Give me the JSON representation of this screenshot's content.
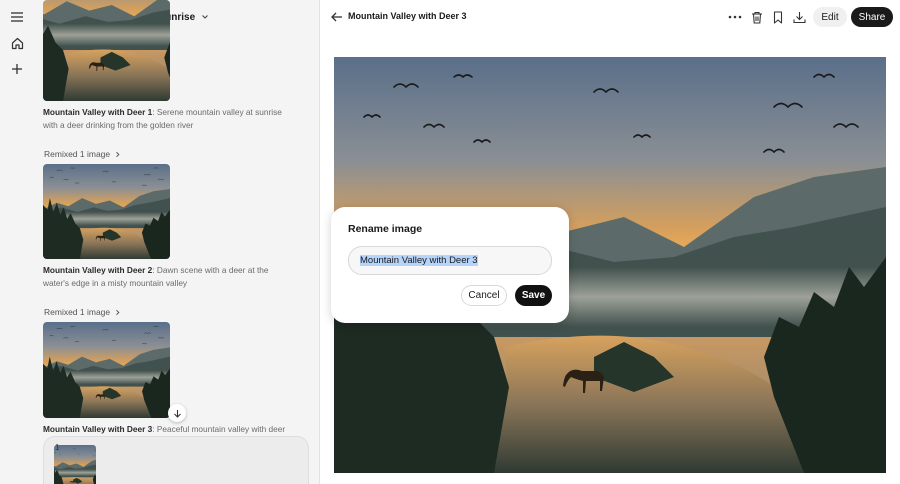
{
  "sidebar": {
    "menu_icon": "hamburger-icon",
    "home_icon": "home-icon",
    "new_icon": "plus-icon"
  },
  "panel": {
    "collection_title": "Serene Mountain Valley Sunrise",
    "items": [
      {
        "name": "Mountain Valley with Deer 1",
        "description": ": Serene mountain valley at sunrise with a deer drinking from the golden river"
      },
      {
        "remix_label": "Remixed 1 image",
        "name": "Mountain Valley with Deer 2",
        "description": ": Dawn scene with a deer at the water's edge in a misty mountain valley"
      },
      {
        "remix_label": "Remixed 1 image",
        "name": "Mountain Valley with Deer 3",
        "description": ": Peaceful mountain valley with deer"
      }
    ],
    "tray_count": "1"
  },
  "header": {
    "title": "Mountain Valley with Deer 3",
    "edit_label": "Edit",
    "share_label": "Share",
    "tools": [
      "more-icon",
      "trash-icon",
      "bookmark-icon",
      "download-icon"
    ]
  },
  "modal": {
    "title": "Rename image",
    "input_value": "Mountain Valley with Deer 3",
    "cancel_label": "Cancel",
    "save_label": "Save"
  },
  "colors": {
    "accent": "#111111",
    "selection": "#b5d4fb",
    "panel_bg": "#f4f4f4"
  }
}
